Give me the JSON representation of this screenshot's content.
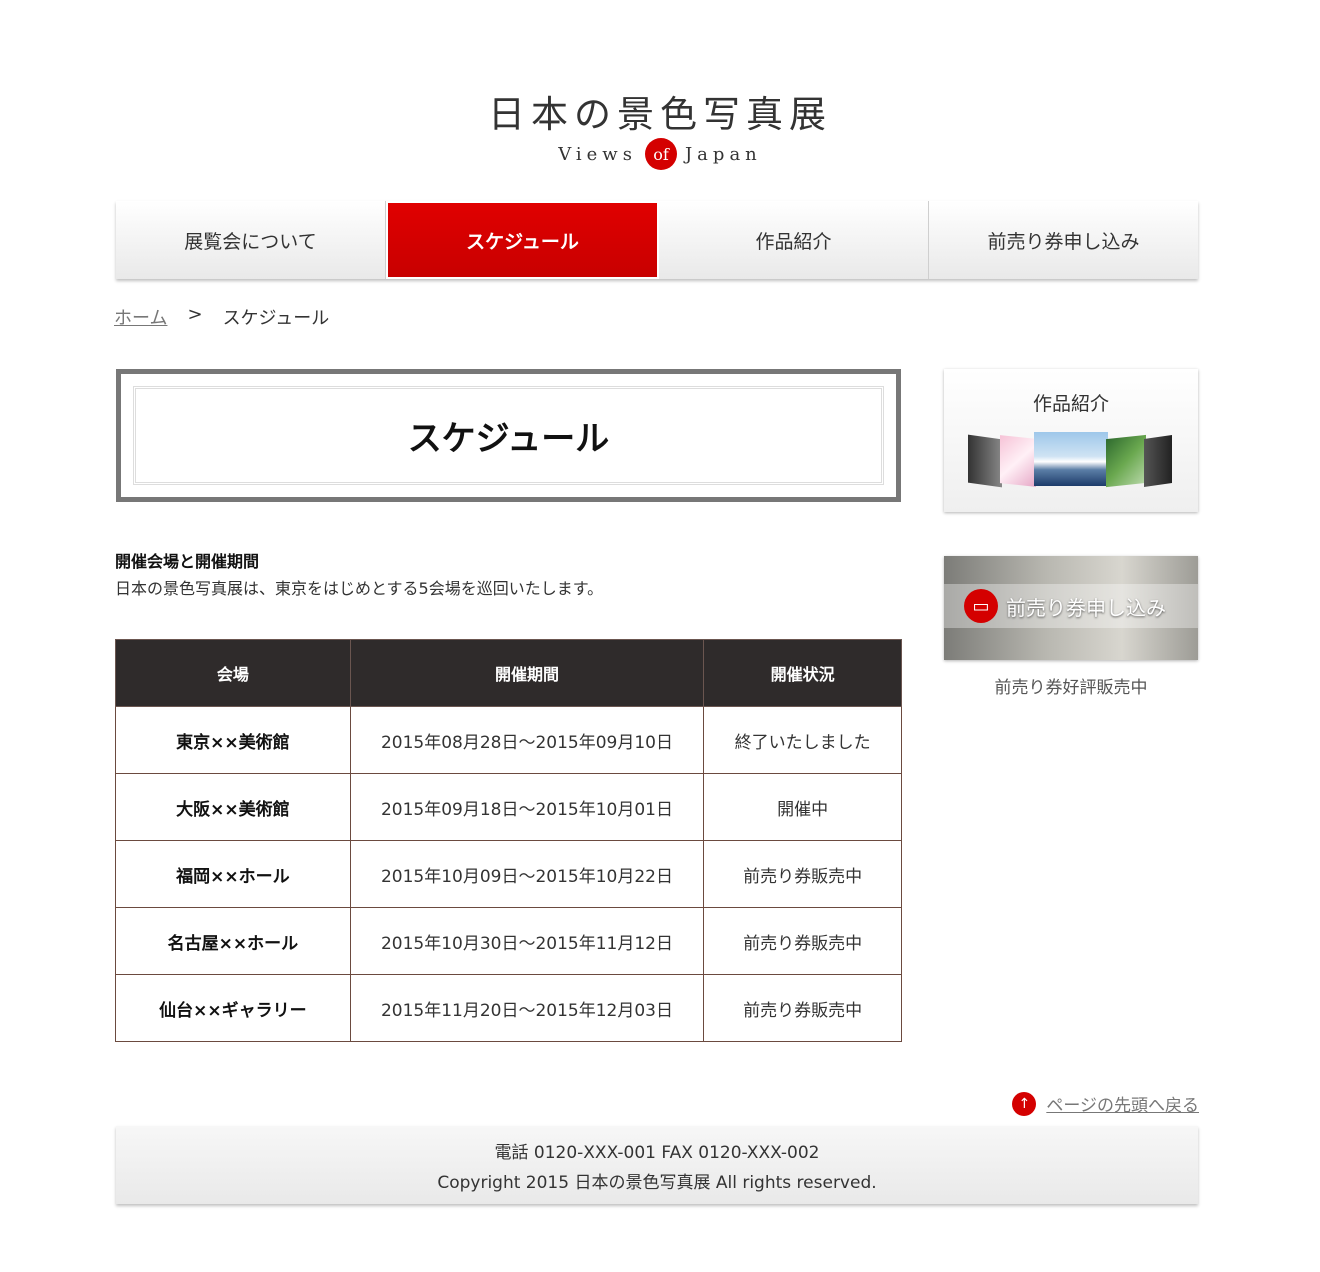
{
  "header": {
    "title": "日本の景色写真展",
    "subtitle_left": "Views",
    "subtitle_mid": "of",
    "subtitle_right": "Japan"
  },
  "nav": [
    {
      "label": "展覧会について"
    },
    {
      "label": "スケジュール",
      "active": true
    },
    {
      "label": "作品紹介"
    },
    {
      "label": "前売り券申し込み"
    }
  ],
  "breadcrumb": {
    "home": "ホーム",
    "separator": ">",
    "current": "スケジュール"
  },
  "page": {
    "heading": "スケジュール",
    "section_title": "開催会場と開催期間",
    "section_desc": "日本の景色写真展は、東京をはじめとする5会場を巡回いたします。"
  },
  "table": {
    "headers": [
      "会場",
      "開催期間",
      "開催状況"
    ],
    "rows": [
      [
        "東京××美術館",
        "2015年08月28日～2015年09月10日",
        "終了いたしました"
      ],
      [
        "大阪××美術館",
        "2015年09月18日～2015年10月01日",
        "開催中"
      ],
      [
        "福岡××ホール",
        "2015年10月09日～2015年10月22日",
        "前売り券販売中"
      ],
      [
        "名古屋××ホール",
        "2015年10月30日～2015年11月12日",
        "前売り券販売中"
      ],
      [
        "仙台××ギャラリー",
        "2015年11月20日～2015年12月03日",
        "前売り券販売中"
      ]
    ]
  },
  "sidebar": {
    "works_title": "作品紹介",
    "ticket_label": "前売り券申し込み",
    "ticket_note": "前売り券好評販売中"
  },
  "to_top": {
    "label": "ページの先頭へ戻る",
    "icon": "arrow-up-icon"
  },
  "footer": {
    "contact": "電話 0120-XXX-001 FAX 0120-XXX-002",
    "copyright": "Copyright 2015 日本の景色写真展 All rights reserved."
  },
  "colors": {
    "accent": "#d40000",
    "table_header": "#2f2b2b"
  }
}
